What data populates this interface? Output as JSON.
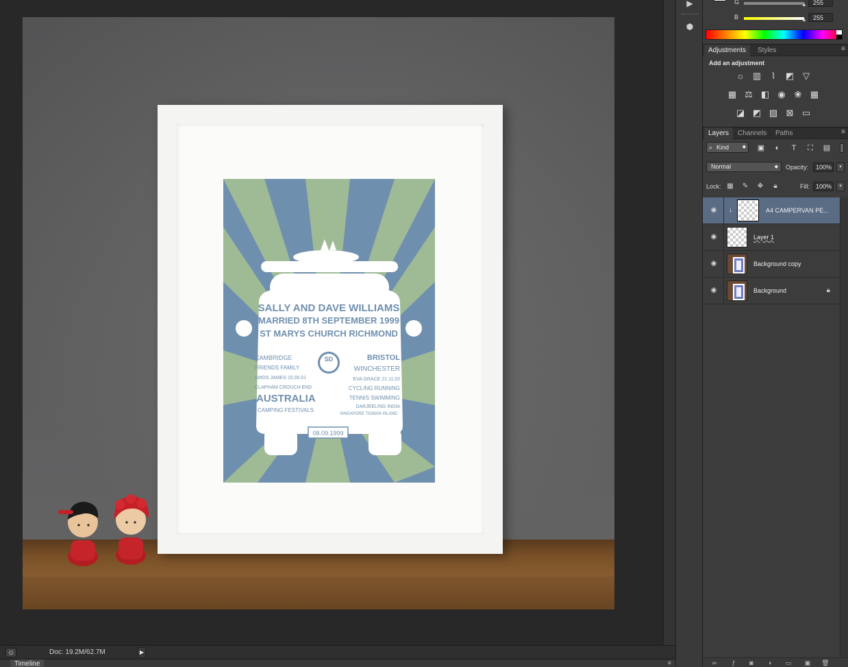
{
  "canvas": {
    "artwork": {
      "headline_lines": [
        "SALLY AND DAVE WILLIAMS",
        "MARRIED 8TH SEPTEMBER 1999",
        "ST MARYS CHURCH RICHMOND"
      ],
      "monogram": "SD",
      "left_words": [
        "CAMBRIDGE",
        "FRIENDS FAMILY",
        "AMOS JAMES 15.05.01",
        "CLAPHAM  CROUCH END",
        "AUSTRALIA",
        "CAMPING FESTIVALS"
      ],
      "right_words": [
        "BRISTOL",
        "WINCHESTER",
        "EVA GRACE 21.11.02",
        "CYCLING  RUNNING",
        "TENNIS  SWIMMING",
        "DARJEELING INDIA",
        "SINGAPORE TIOMAN ISLAND"
      ],
      "plate": "08.09.1999"
    }
  },
  "status": {
    "doc_size": "Doc: 19.2M/62.7M",
    "timeline_tab": "Timeline"
  },
  "color_panel": {
    "g_label": "G",
    "g_value": "255",
    "b_label": "B",
    "b_value": "255"
  },
  "adjustments_panel": {
    "tabs": [
      "Adjustments",
      "Styles"
    ],
    "heading": "Add an adjustment"
  },
  "layers_panel": {
    "tabs": [
      "Layers",
      "Channels",
      "Paths"
    ],
    "kind_label": "Kind",
    "blend_mode": "Normal",
    "opacity_label": "Opacity:",
    "opacity_value": "100%",
    "lock_label": "Lock:",
    "fill_label": "Fill:",
    "fill_value": "100%",
    "layers": [
      {
        "name": "A4 CAMPERVAN PE..."
      },
      {
        "name": "Layer 1"
      },
      {
        "name": "Background copy"
      },
      {
        "name": "Background"
      }
    ]
  },
  "colors": {
    "panel_bg": "#3c3c3c",
    "selected_layer": "#5a6b84",
    "print_blue": "#6f8faf",
    "print_green": "#9fbb96"
  }
}
